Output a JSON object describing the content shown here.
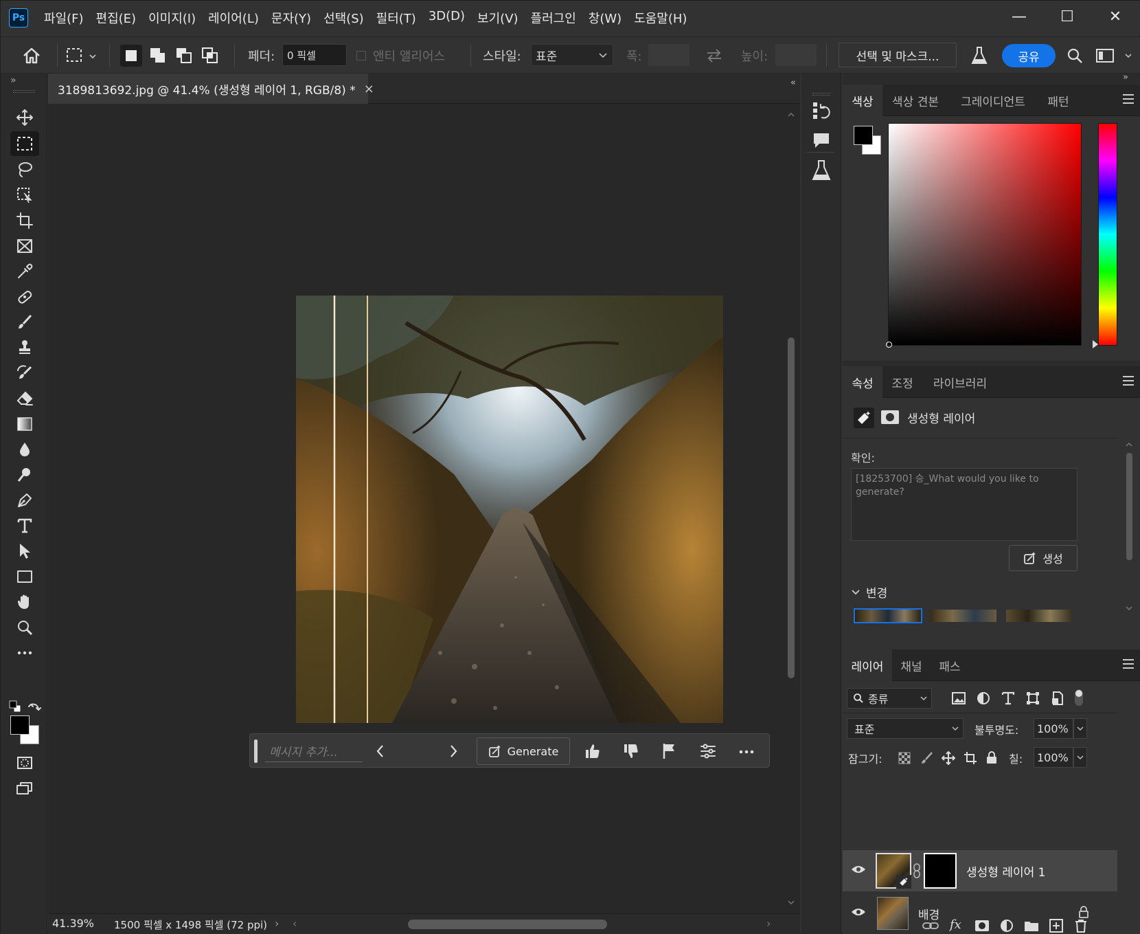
{
  "app": {
    "logo_text": "Ps"
  },
  "menu": [
    "파일(F)",
    "편집(E)",
    "이미지(I)",
    "레이어(L)",
    "문자(Y)",
    "선택(S)",
    "필터(T)",
    "3D(D)",
    "보기(V)",
    "플러그인",
    "창(W)",
    "도움말(H)"
  ],
  "window_controls": {
    "minimize": "—",
    "maximize": "☐",
    "close": "✕"
  },
  "options": {
    "feather_label": "페더:",
    "feather_value": "0 픽셀",
    "antialias_label": "앤티 앨리어스",
    "style_label": "스타일:",
    "style_value": "표준",
    "width_label": "폭:",
    "height_label": "높이:",
    "select_mask_label": "선택 및 마스크...",
    "share_label": "공유"
  },
  "document": {
    "tab_title": "3189813692.jpg @ 41.4% (생성형 레이어 1, RGB/8) *",
    "close_glyph": "×"
  },
  "gen_bar": {
    "placeholder": "메시지 추가...",
    "generate_label": "Generate"
  },
  "status": {
    "zoom": "41.39%",
    "doc_info": "1500 픽셀 x 1498 픽셀 (72 ppi)"
  },
  "color_panel": {
    "tabs": [
      "색상",
      "색상 견본",
      "그레이디언트",
      "패턴"
    ],
    "active_tab": 0,
    "hue_color": "#ff0000"
  },
  "properties_panel": {
    "tabs": [
      "속성",
      "조정",
      "라이브러리"
    ],
    "active_tab": 0,
    "layer_type": "생성형 레이어",
    "prompt_label": "확인:",
    "prompt_text": "[18253700] 승_What would you like to generate?",
    "generate_button": "생성",
    "variations_label": "변경"
  },
  "layers_panel": {
    "tabs": [
      "레이어",
      "채널",
      "패스"
    ],
    "active_tab": 0,
    "filter_label": "종류",
    "blend_mode": "표준",
    "opacity_label": "불투명도:",
    "opacity_value": "100%",
    "lock_label": "잠그기:",
    "fill_label": "칠:",
    "fill_value": "100%",
    "layers": [
      {
        "name": "생성형 레이어 1",
        "selected": true
      },
      {
        "name": "배경",
        "selected": false
      }
    ]
  },
  "accent_color": "#1473e6"
}
